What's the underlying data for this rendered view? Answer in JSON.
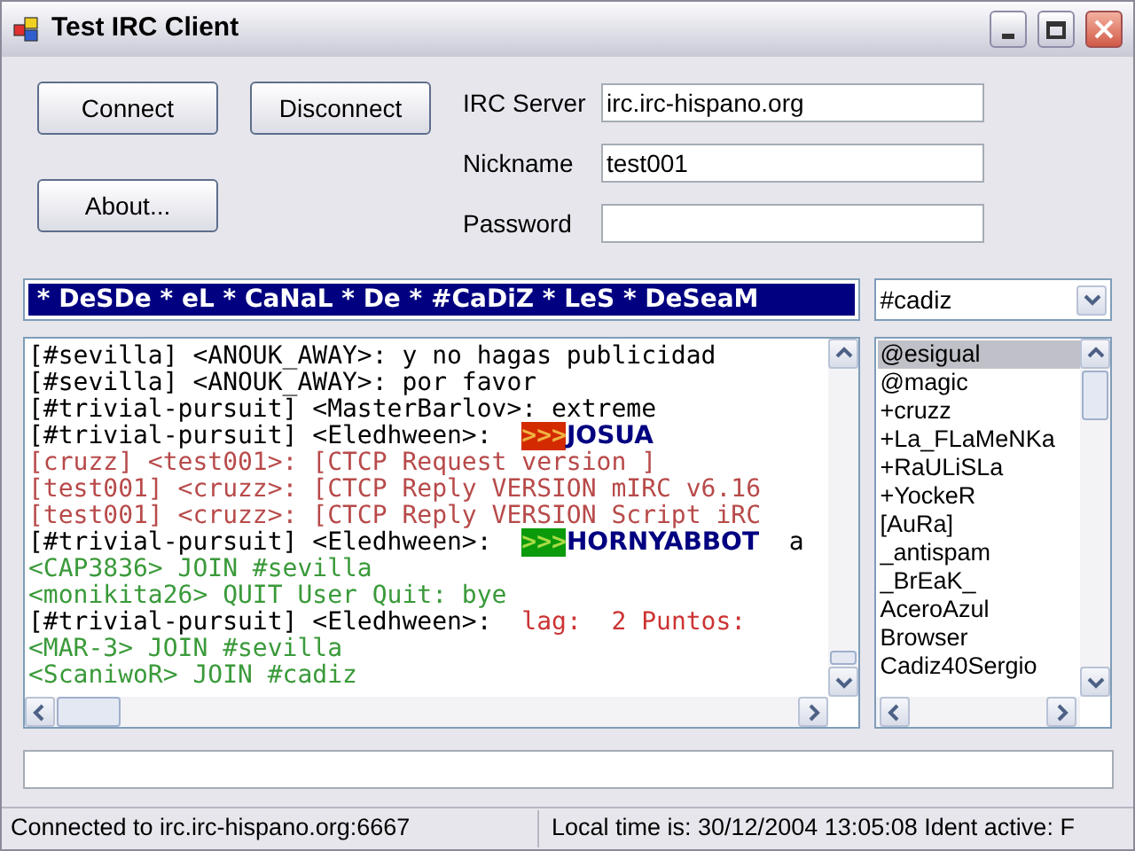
{
  "window": {
    "title": "Test IRC Client"
  },
  "buttons": [
    {
      "label": "Connect"
    },
    {
      "label": "Disconnect"
    },
    {
      "label": "About..."
    }
  ],
  "fields": [
    {
      "label": "IRC Server",
      "value": "irc.irc-hispano.org"
    },
    {
      "label": "Nickname",
      "value": "test001"
    },
    {
      "label": "Password"
    }
  ],
  "topic": {
    "text": " * DeSDe * eL * CaNaL * De * #CaDiZ * LeS * DeSeaM"
  },
  "channel_select": {
    "value": "#cadiz"
  },
  "chat": {
    "lines": [
      {
        "segments": [
          {
            "kind": "text",
            "text": "[#sevilla] <ANOUK_AWAY>: y no hagas publicidad",
            "color": "#000000"
          }
        ]
      },
      {
        "segments": [
          {
            "kind": "text",
            "text": "[#sevilla] <ANOUK_AWAY>: por favor",
            "color": "#000000"
          }
        ]
      },
      {
        "segments": [
          {
            "kind": "text",
            "text": "[#trivial-pursuit] <MasterBarlov>: extreme",
            "color": "#000000"
          }
        ]
      },
      {
        "segments": [
          {
            "kind": "text",
            "text": "[#trivial-pursuit] <Eledhween>:  ",
            "color": "#000000"
          },
          {
            "kind": "arrows",
            "text": ">>>",
            "color": "#d42a00"
          },
          {
            "kind": "bold",
            "text": "JOSUA",
            "color": "#000080"
          }
        ]
      },
      {
        "segments": [
          {
            "kind": "text",
            "text": "[cruzz] <test001>: [CTCP Request version ]",
            "color": "#b84a4a"
          }
        ]
      },
      {
        "segments": [
          {
            "kind": "text",
            "text": "[test001] <cruzz>: [CTCP Reply VERSION mIRC v6.16",
            "color": "#b84a4a"
          }
        ]
      },
      {
        "segments": [
          {
            "kind": "text",
            "text": "[test001] <cruzz>: [CTCP Reply VERSION Script iRC",
            "color": "#b84a4a"
          }
        ]
      },
      {
        "segments": [
          {
            "kind": "text",
            "text": "[#trivial-pursuit] <Eledhween>:  ",
            "color": "#000000"
          },
          {
            "kind": "arrows",
            "text": ">>>",
            "color": "#0a9a0a"
          },
          {
            "kind": "bold",
            "text": "HORNYABBOT",
            "color": "#000080"
          },
          {
            "kind": "text",
            "text": "  a",
            "color": "#000000"
          }
        ]
      },
      {
        "segments": [
          {
            "kind": "text",
            "text": "<CAP3836> JOIN #sevilla",
            "color": "#3a9a3a"
          }
        ]
      },
      {
        "segments": [
          {
            "kind": "text",
            "text": "<monikita26> QUIT User Quit: bye",
            "color": "#3a9a3a"
          }
        ]
      },
      {
        "segments": [
          {
            "kind": "text",
            "text": "[#trivial-pursuit] <Eledhween>:  ",
            "color": "#000000"
          },
          {
            "kind": "text",
            "text": "lag:  2 Puntos:",
            "color": "#cc3333"
          }
        ]
      },
      {
        "segments": [
          {
            "kind": "text",
            "text": "<MAR-3> JOIN #sevilla",
            "color": "#3a9a3a"
          }
        ]
      },
      {
        "segments": [
          {
            "kind": "text",
            "text": "<ScaniwoR> JOIN #cadiz",
            "color": "#3a9a3a"
          }
        ]
      }
    ]
  },
  "users": [
    {
      "name": "@esigual",
      "selected": true
    },
    {
      "name": "@magic",
      "selected": false
    },
    {
      "name": "+cruzz",
      "selected": false
    },
    {
      "name": "+La_FLaMeNKa",
      "selected": false
    },
    {
      "name": "+RaULiSLa",
      "selected": false
    },
    {
      "name": "+YockeR",
      "selected": false
    },
    {
      "name": "[AuRa]",
      "selected": false
    },
    {
      "name": "_antispam",
      "selected": false
    },
    {
      "name": "_BrEaK_",
      "selected": false
    },
    {
      "name": "AceroAzul",
      "selected": false
    },
    {
      "name": "Browser",
      "selected": false
    },
    {
      "name": "Cadiz40Sergio",
      "selected": false
    }
  ],
  "status_bar": [
    "Connected to irc.irc-hispano.org:6667",
    "Local time is: 30/12/2004 13:05:08 Ident active: F"
  ]
}
